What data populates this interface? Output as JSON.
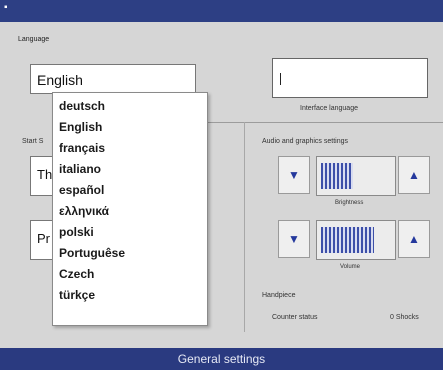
{
  "window": {
    "system_icon": "window-menu-icon"
  },
  "language": {
    "group_label": "Language",
    "selected": "English",
    "options": [
      "deutsch",
      "English",
      "français",
      "italiano",
      "español",
      "ελληνικά",
      "polski",
      "Portuguêse",
      "Czech",
      "türkçe"
    ]
  },
  "right_input": {
    "value": "",
    "caption": "Interface language"
  },
  "start": {
    "label": "Start S",
    "field1_text": "Th",
    "field2_text": "Pr"
  },
  "audio_graphics": {
    "label": "Audio and graphics settings",
    "brightness_caption": "Brightness",
    "volume_caption": "Volume",
    "brightness_level": 0.45,
    "volume_level": 0.75,
    "decrease_icon": "triangle-down-icon",
    "increase_icon": "triangle-up-icon"
  },
  "handpiece": {
    "label": "Handpiece",
    "status_label": "Counter status",
    "shocks": "0 Shocks"
  },
  "statusbar": {
    "title": "General settings"
  }
}
